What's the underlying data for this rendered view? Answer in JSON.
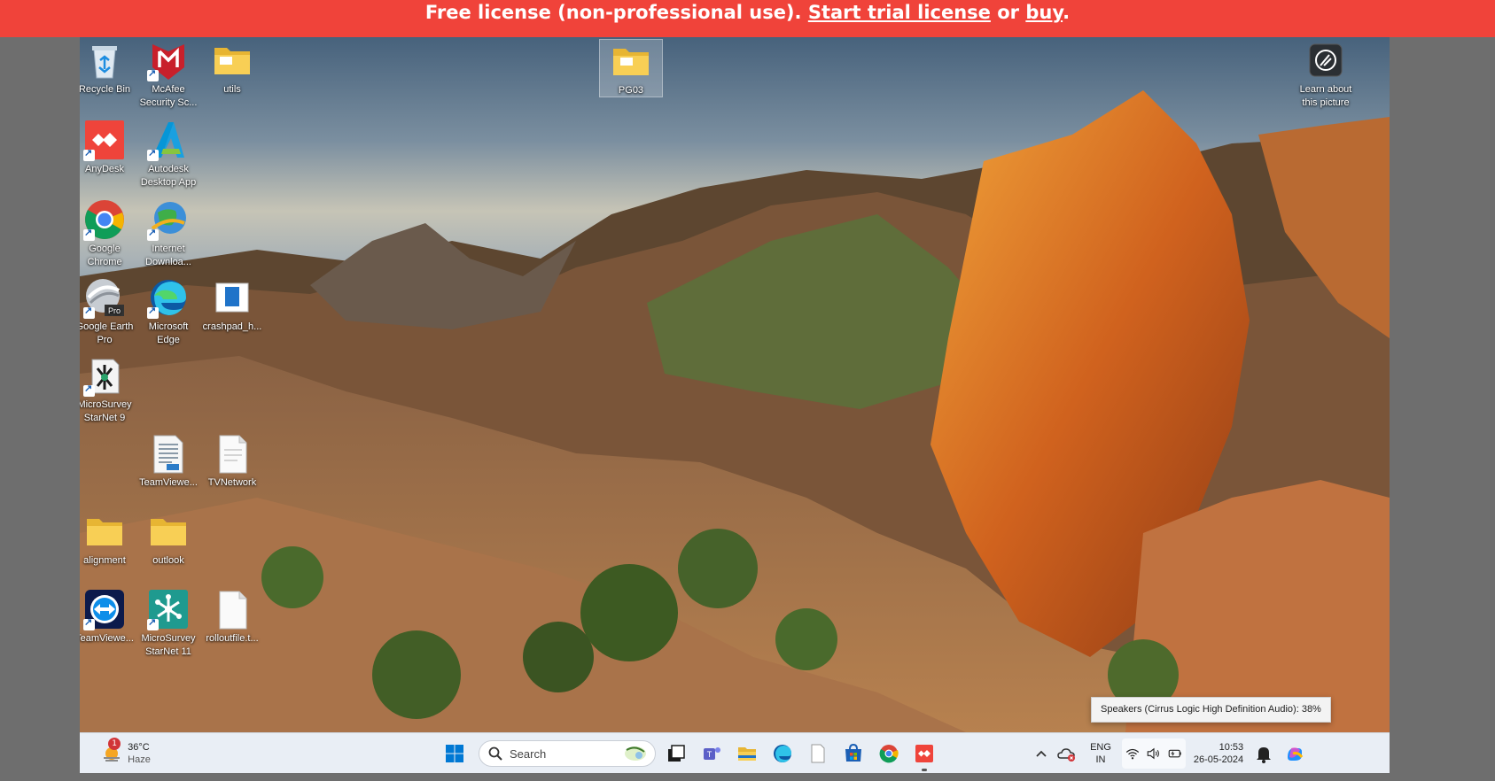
{
  "banner": {
    "prefix": "Free license (non-professional use).",
    "trial_link": "Start trial license",
    "middle": "or",
    "buy_link": "buy",
    "suffix": "."
  },
  "desktop": {
    "icons": {
      "recycle_bin": "Recycle Bin",
      "mcafee": "McAfee Security Sc...",
      "utils": "utils",
      "pg03": "PG03",
      "learn": "Learn about this picture",
      "anydesk": "AnyDesk",
      "autodesk": "Autodesk Desktop App",
      "chrome": "Google Chrome",
      "idm": "Internet Downloa...",
      "earth": "Google Earth Pro",
      "edge": "Microsoft Edge",
      "crashpad": "crashpad_h...",
      "starnet9": "MicroSurvey StarNet 9",
      "teamviewer_doc": "TeamViewe...",
      "tvnetwork": "TVNetwork",
      "alignment": "alignment",
      "outlook": "outlook",
      "teamviewer": "TeamViewe...",
      "starnet11": "MicroSurvey StarNet 11",
      "rollout": "rolloutfile.t..."
    },
    "earth_badge": "Pro"
  },
  "tooltip": "Speakers (Cirrus Logic High Definition Audio): 38%",
  "taskbar": {
    "weather": {
      "temp": "36°C",
      "condition": "Haze",
      "badge": "1"
    },
    "search_label": "Search",
    "tray": {
      "lang_top": "ENG",
      "lang_bottom": "IN",
      "time": "10:53",
      "date": "26-05-2024"
    }
  },
  "colors": {
    "banner": "#f0433a",
    "taskbar": "#e9eef5",
    "accent": "#0078d4"
  }
}
